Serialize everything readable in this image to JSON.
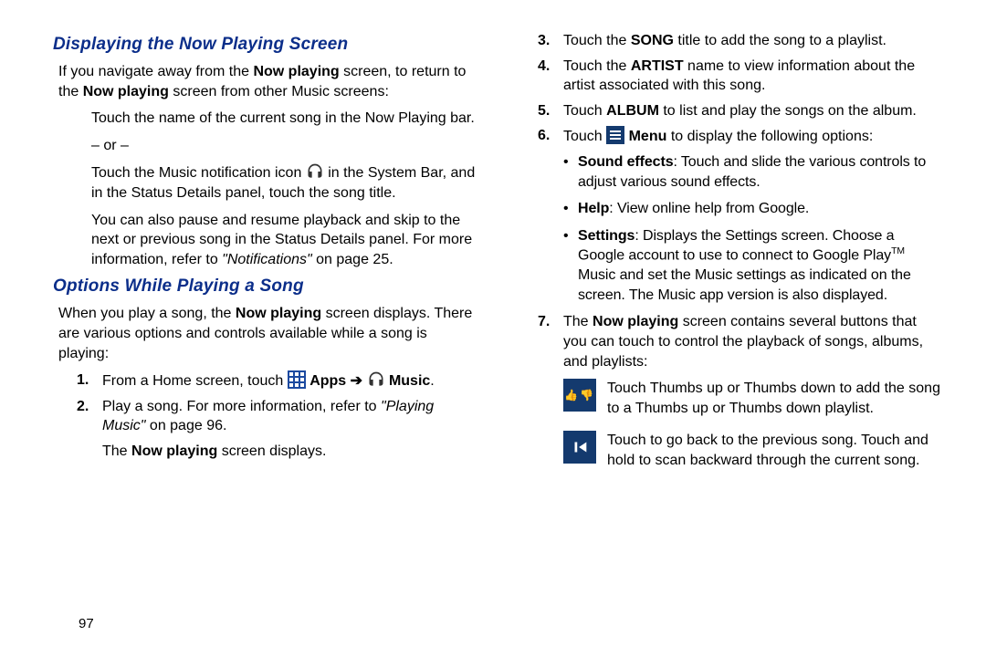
{
  "page_number": "97",
  "left": {
    "heading1": "Displaying the Now Playing Screen",
    "intro_a": "If you navigate away from the ",
    "intro_b": "Now playing",
    "intro_c": " screen, to return to the ",
    "intro_d": "Now playing",
    "intro_e": " screen from other Music screens:",
    "opt1": "Touch the name of the current song in the Now Playing bar.",
    "or": "– or –",
    "opt2a": "Touch the Music notification icon ",
    "opt2b": " in the System Bar, and in the Status Details panel, touch the song title.",
    "opt3a": "You can also pause and resume playback and skip to the next or previous song in the Status Details panel. For more information, refer to ",
    "opt3xref": "\"Notifications\"",
    "opt3b": " on page 25.",
    "heading2": "Options While Playing a Song",
    "intro2a": "When you play a song, the ",
    "intro2b": "Now playing",
    "intro2c": " screen displays. There are various options and controls available while a song is playing:",
    "step1n": "1.",
    "step1a": "From a Home screen, touch ",
    "step1apps": "Apps",
    "step1arrow": " ➔ ",
    "step1music": "Music",
    "step1end": ".",
    "step2n": "2.",
    "step2a": "Play a song. For more information, refer to ",
    "step2xref": "\"Playing Music\"",
    "step2b": " on page 96.",
    "step2c": "The ",
    "step2d": "Now playing",
    "step2e": " screen displays."
  },
  "right": {
    "step3n": "3.",
    "step3a": "Touch the ",
    "step3b": "SONG",
    "step3c": " title to add the song to a playlist.",
    "step4n": "4.",
    "step4a": "Touch the ",
    "step4b": "ARTIST",
    "step4c": " name to view information about the artist associated with this song.",
    "step5n": "5.",
    "step5a": "Touch ",
    "step5b": "ALBUM",
    "step5c": " to list and play the songs on the album.",
    "step6n": "6.",
    "step6a": "Touch ",
    "step6b": "Menu",
    "step6c": " to display the following options:",
    "b1a": "Sound effects",
    "b1b": ": Touch and slide the various controls to adjust various sound effects.",
    "b2a": "Help",
    "b2b": ": View online help from Google.",
    "b3a": "Settings",
    "b3b_1": ": Displays the Settings screen. Choose a Google account to use to connect to Google Play",
    "b3b_tm": "TM",
    "b3b_2": " Music and set the Music settings as indicated on the screen. The Music app version is also displayed.",
    "step7n": "7.",
    "step7a": "The ",
    "step7b": "Now playing",
    "step7c": " screen contains several buttons that you can touch to control the playback of songs, albums, and playlists:",
    "thumbs": "Touch Thumbs up or Thumbs down to add the song to a Thumbs up or Thumbs down playlist.",
    "prev": "Touch to go back to the previous song. Touch and hold to scan backward through the current song."
  }
}
